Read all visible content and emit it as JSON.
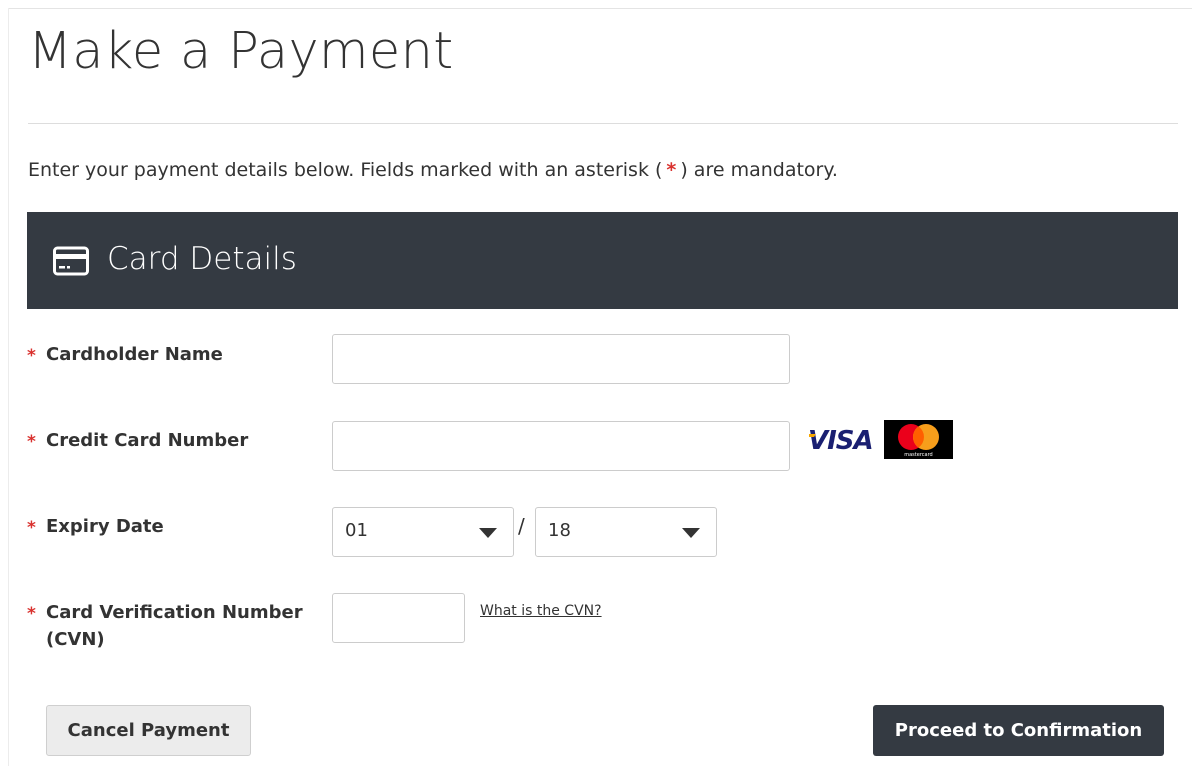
{
  "page": {
    "title": "Make a Payment",
    "intro_before": "Enter your payment details below. Fields marked with an asterisk (",
    "intro_star": "*",
    "intro_after": ") are mandatory."
  },
  "panel": {
    "title": "Card Details",
    "icon": "credit-card-icon"
  },
  "form": {
    "required_marker": "*",
    "cardholder_name": {
      "label": "Cardholder Name",
      "value": "",
      "placeholder": ""
    },
    "card_number": {
      "label": "Credit Card Number",
      "value": "",
      "placeholder": ""
    },
    "expiry": {
      "label": "Expiry Date",
      "month": "01",
      "separator": "/",
      "year": "18"
    },
    "cvn": {
      "label_line1": "Card Verification Number",
      "label_line2": "(CVN)",
      "value": "",
      "help_link": "What is the CVN?"
    },
    "card_logos": {
      "visa": "VISA",
      "mastercard": "mastercard"
    }
  },
  "actions": {
    "cancel_label": "Cancel Payment",
    "proceed_label": "Proceed to Confirmation"
  },
  "colors": {
    "accent_dark": "#343a42",
    "required": "#d9322f",
    "visa_blue": "#1a1f71",
    "visa_gold": "#f7a600",
    "mc_red": "#eb001b",
    "mc_orange": "#f79e1b"
  }
}
